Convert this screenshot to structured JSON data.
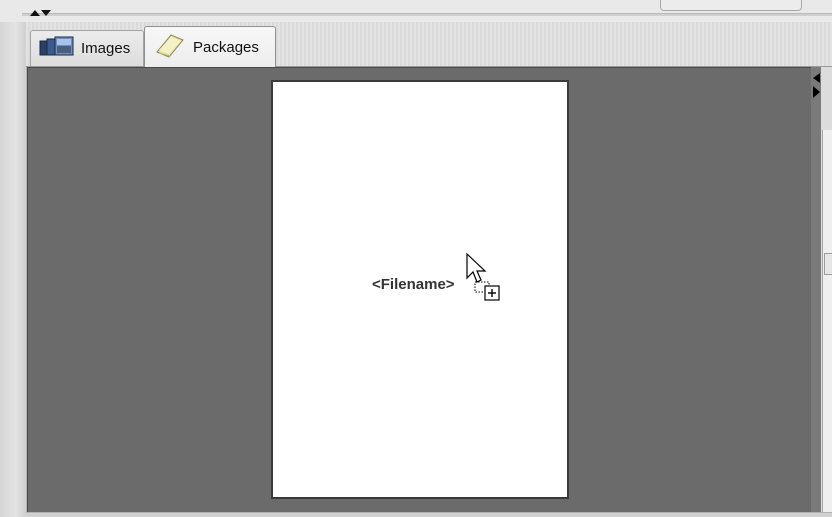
{
  "tabs": [
    {
      "label": "Images",
      "icon": "images-stack-icon"
    },
    {
      "label": "Packages",
      "icon": "package-icon",
      "active": true
    }
  ],
  "canvas": {
    "background": "#6b6b6b",
    "page_background": "#ffffff",
    "placeholder_text": "<Filename>"
  },
  "cursor": {
    "icon": "drag-copy-cursor-icon"
  }
}
